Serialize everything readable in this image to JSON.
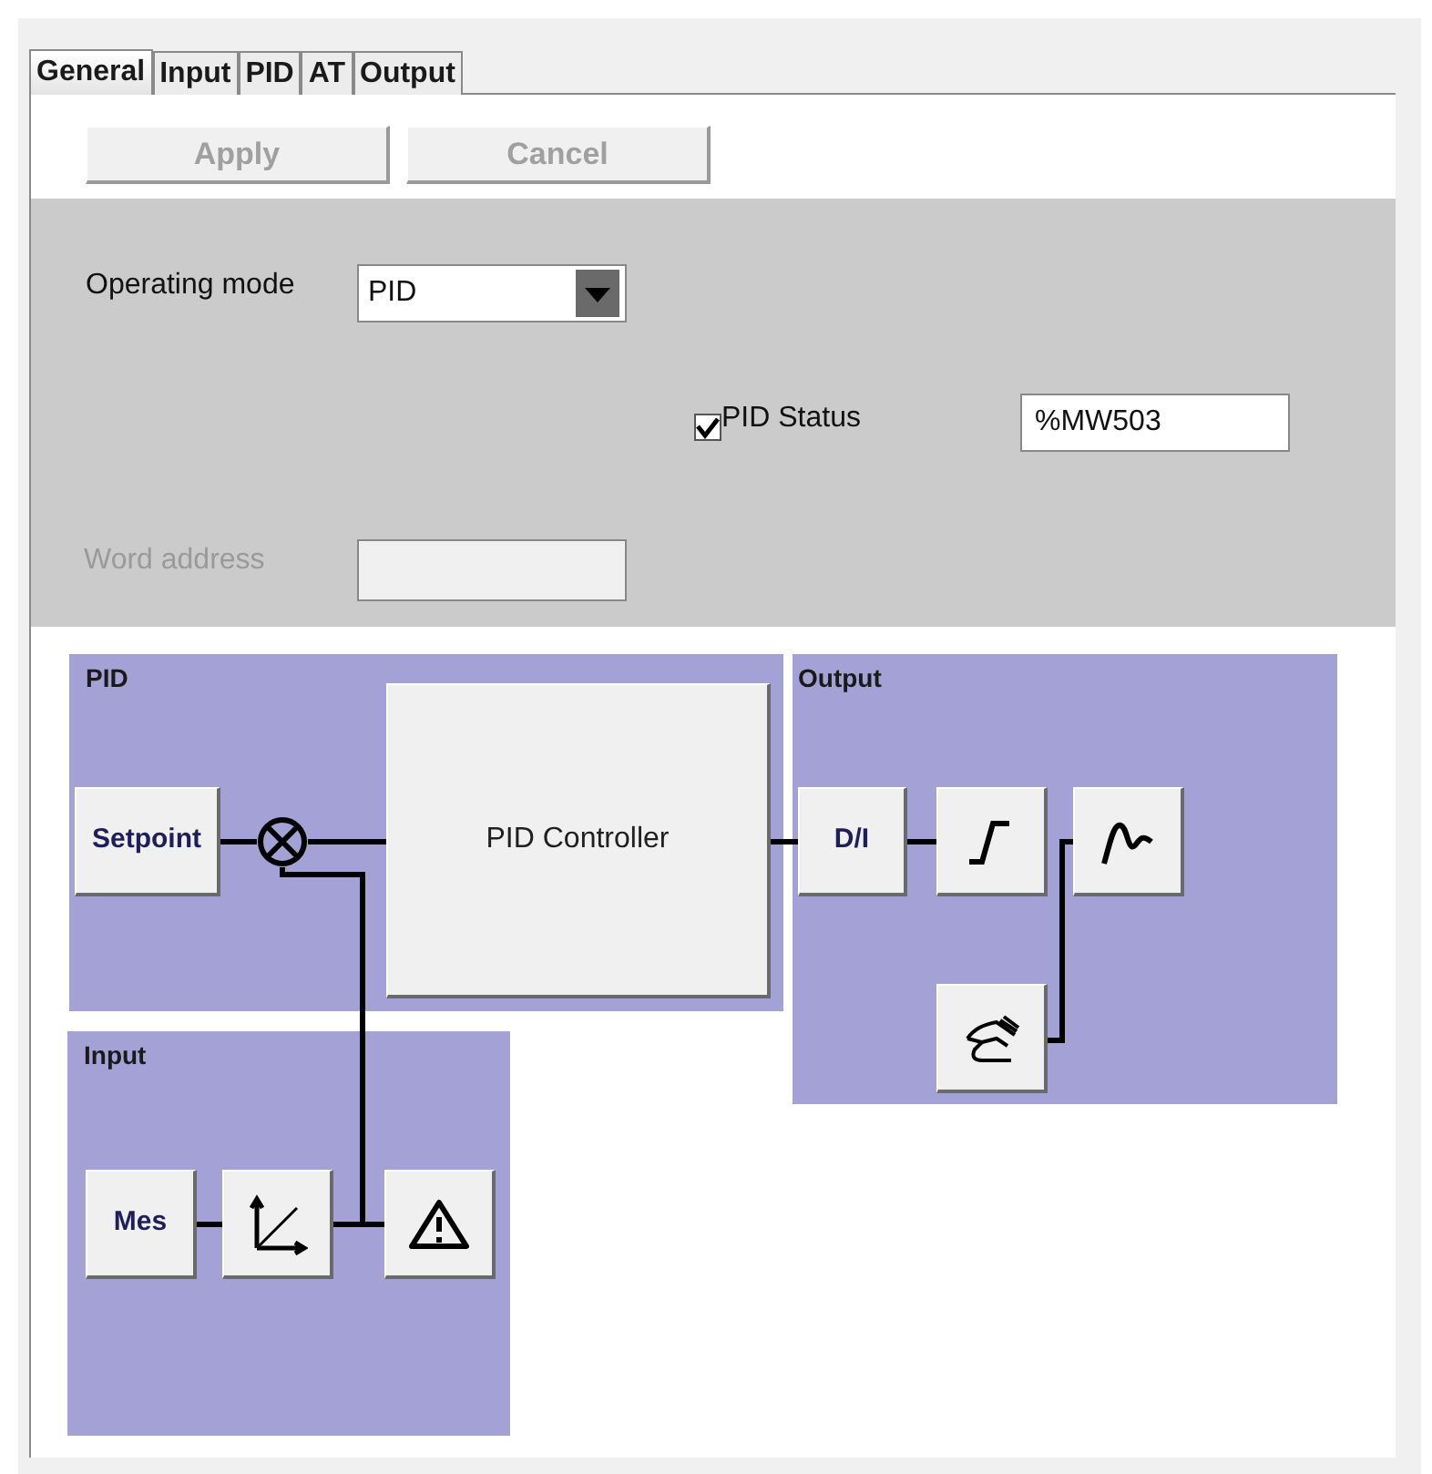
{
  "tabs": [
    {
      "label": "General",
      "selected": true
    },
    {
      "label": "Input",
      "selected": false
    },
    {
      "label": "PID",
      "selected": false
    },
    {
      "label": "AT",
      "selected": false
    },
    {
      "label": "Output",
      "selected": false
    }
  ],
  "toolbar": {
    "buttons": [
      {
        "label": "Apply",
        "disabled": true
      },
      {
        "label": "Cancel",
        "disabled": true
      }
    ]
  },
  "settings": {
    "operating_mode": {
      "label": "Operating mode",
      "value": "PID"
    },
    "pid_status": {
      "label": "PID Status",
      "checked": true,
      "value": "%MW503"
    },
    "word_address": {
      "label": "Word address",
      "disabled": true
    }
  },
  "diagram": {
    "panels": [
      {
        "title": "PID",
        "blocks": [
          {
            "kind": "text",
            "label": "Setpoint"
          },
          {
            "kind": "sum"
          },
          {
            "kind": "large",
            "label": "PID Controller"
          }
        ]
      },
      {
        "title": "Output",
        "blocks": [
          {
            "kind": "text",
            "label": "D/I"
          },
          {
            "kind": "ramp"
          },
          {
            "kind": "response"
          },
          {
            "kind": "hand"
          }
        ]
      },
      {
        "title": "Input",
        "blocks": [
          {
            "kind": "text",
            "label": "Mes"
          },
          {
            "kind": "scale"
          },
          {
            "kind": "warning"
          }
        ]
      }
    ]
  }
}
